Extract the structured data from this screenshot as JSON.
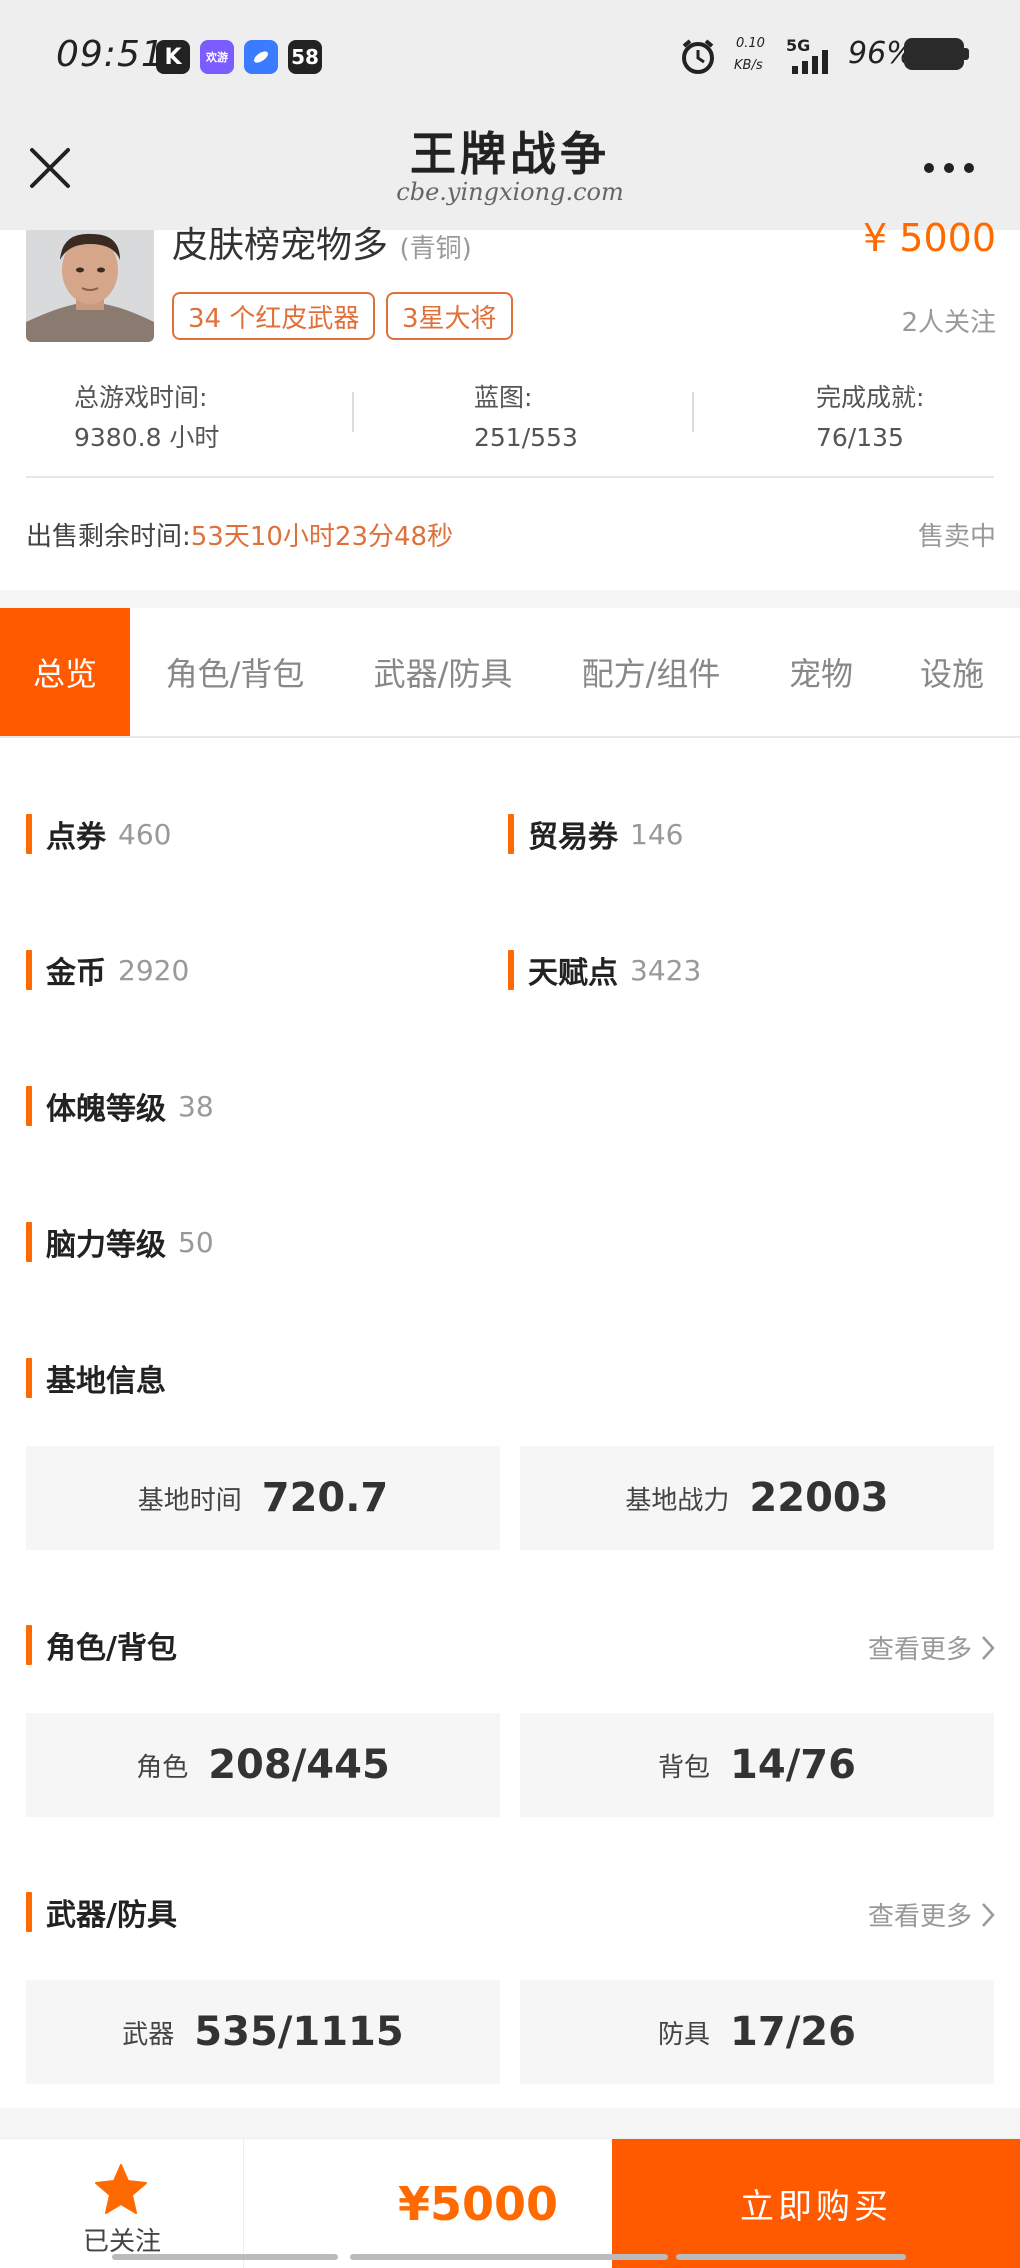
{
  "status_bar": {
    "time": "09:51",
    "badges": [
      {
        "text": "K",
        "color": "#222222"
      },
      {
        "text": "欢游",
        "color": "#7b5cff"
      },
      {
        "text": "",
        "color": "#3a7bff"
      },
      {
        "text": "58",
        "color": "#222222"
      }
    ],
    "net_speed": "0.10",
    "net_unit": "KB/s",
    "network": "5G",
    "battery": "96%"
  },
  "header": {
    "title": "王牌战争",
    "subtitle": "cbe.yingxiong.com"
  },
  "product": {
    "name": "皮肤榜宠物多",
    "tier": "(青铜)",
    "price": "¥ 5000",
    "tags": [
      "34 个红皮武器",
      "3星大将"
    ],
    "watchers": "2人关注",
    "stats": [
      {
        "label": "总游戏时间:",
        "value": "9380.8 小时"
      },
      {
        "label": "蓝图:",
        "value": "251/553"
      },
      {
        "label": "完成成就:",
        "value": "76/135"
      }
    ],
    "remaining_label": "出售剩余时间:",
    "remaining_value": "53天10小时23分48秒",
    "sale_status": "售卖中"
  },
  "tabs": [
    "总览",
    "角色/背包",
    "武器/防具",
    "配方/组件",
    "宠物",
    "设施"
  ],
  "overview": {
    "items": [
      {
        "label": "点券",
        "value": "460"
      },
      {
        "label": "贸易券",
        "value": "146"
      },
      {
        "label": "金币",
        "value": "2920"
      },
      {
        "label": "天赋点",
        "value": "3423"
      },
      {
        "label": "体魄等级",
        "value": "38"
      },
      {
        "label": "脑力等级",
        "value": "50"
      }
    ],
    "base": {
      "title": "基地信息",
      "cells": [
        {
          "label": "基地时间",
          "value": "720.7"
        },
        {
          "label": "基地战力",
          "value": "22003"
        }
      ]
    },
    "role": {
      "title": "角色/背包",
      "more": "查看更多",
      "cells": [
        {
          "label": "角色",
          "value": "208/445"
        },
        {
          "label": "背包",
          "value": "14/76"
        }
      ]
    },
    "weapon": {
      "title": "武器/防具",
      "more": "查看更多",
      "cells": [
        {
          "label": "武器",
          "value": "535/1115"
        },
        {
          "label": "防具",
          "value": "17/26"
        }
      ]
    }
  },
  "bottom_bar": {
    "follow_label": "已关注",
    "price": "¥5000",
    "buy_label": "立即购买"
  },
  "colors": {
    "accent": "#ff5a00",
    "tag_border": "#e0703a"
  }
}
